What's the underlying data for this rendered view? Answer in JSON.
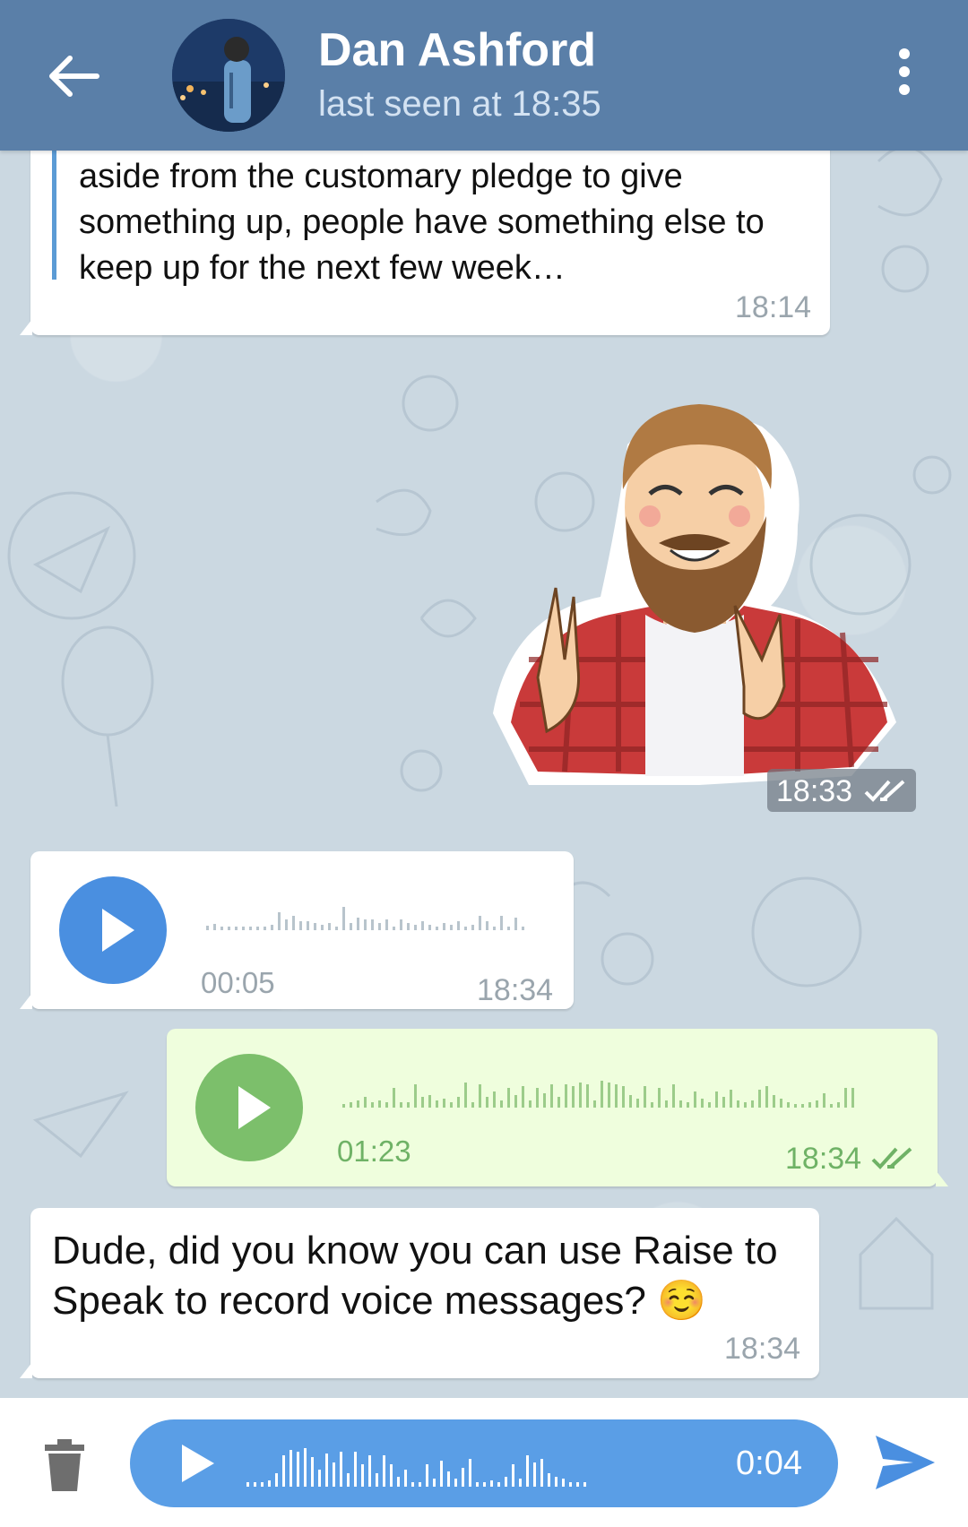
{
  "header": {
    "title": "Dan Ashford",
    "status": "last seen at 18:35"
  },
  "messages": [
    {
      "direction": "incoming",
      "text": "aside from the customary pledge to give something up, people have something else to keep up for the next few week…",
      "time": "18:14"
    },
    {
      "direction": "outgoing",
      "kind": "sticker",
      "time": "18:33"
    },
    {
      "direction": "incoming",
      "kind": "voice",
      "duration": "00:05",
      "time": "18:34"
    },
    {
      "direction": "outgoing",
      "kind": "voice",
      "duration": "01:23",
      "time": "18:34"
    },
    {
      "direction": "incoming",
      "text": "Dude, did you know you can use Raise to Speak to record voice messages? ☺️",
      "time": "18:34"
    }
  ],
  "recorder": {
    "time": "0:04"
  },
  "colors": {
    "header": "#5a7fa8",
    "incoming_play": "#4a8fe0",
    "outgoing_play": "#7cbf6b",
    "recorder": "#5a9ee6",
    "send": "#4a8fe0"
  }
}
